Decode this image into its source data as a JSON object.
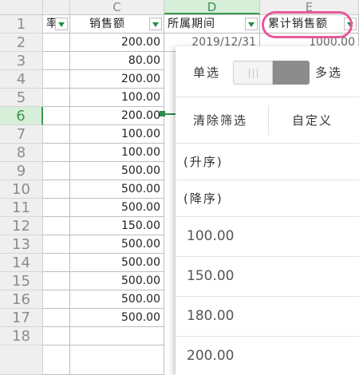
{
  "columns": [
    "C",
    "D",
    "E"
  ],
  "row_numbers": [
    "1",
    "2",
    "3",
    "4",
    "5",
    "6",
    "7",
    "8",
    "9",
    "10",
    "11",
    "12",
    "13",
    "14",
    "15",
    "16",
    "17",
    "18"
  ],
  "headers": {
    "partial_b": "率",
    "sales_amount": "销售额",
    "period": "所属期间",
    "cumulative": "累计销售额"
  },
  "sales_values": [
    "200.00",
    "80.00",
    "200.00",
    "100.00",
    "200.00",
    "100.00",
    "100.00",
    "500.00",
    "500.00",
    "500.00",
    "150.00",
    "500.00",
    "500.00",
    "500.00",
    "500.00",
    "500.00"
  ],
  "partial_row2": {
    "period": "2019/12/31",
    "cumulative": "1000.00"
  },
  "filter_panel": {
    "single_select": "单选",
    "multi_select": "多选",
    "clear_filter": "清除筛选",
    "custom": "自定义",
    "sort_ascending": "(升序)",
    "sort_descending": "(降序)",
    "values": [
      "100.00",
      "150.00",
      "180.00",
      "200.00"
    ]
  },
  "colors": {
    "accent": "#1f8f44",
    "highlight_circle": "#e9589a"
  }
}
